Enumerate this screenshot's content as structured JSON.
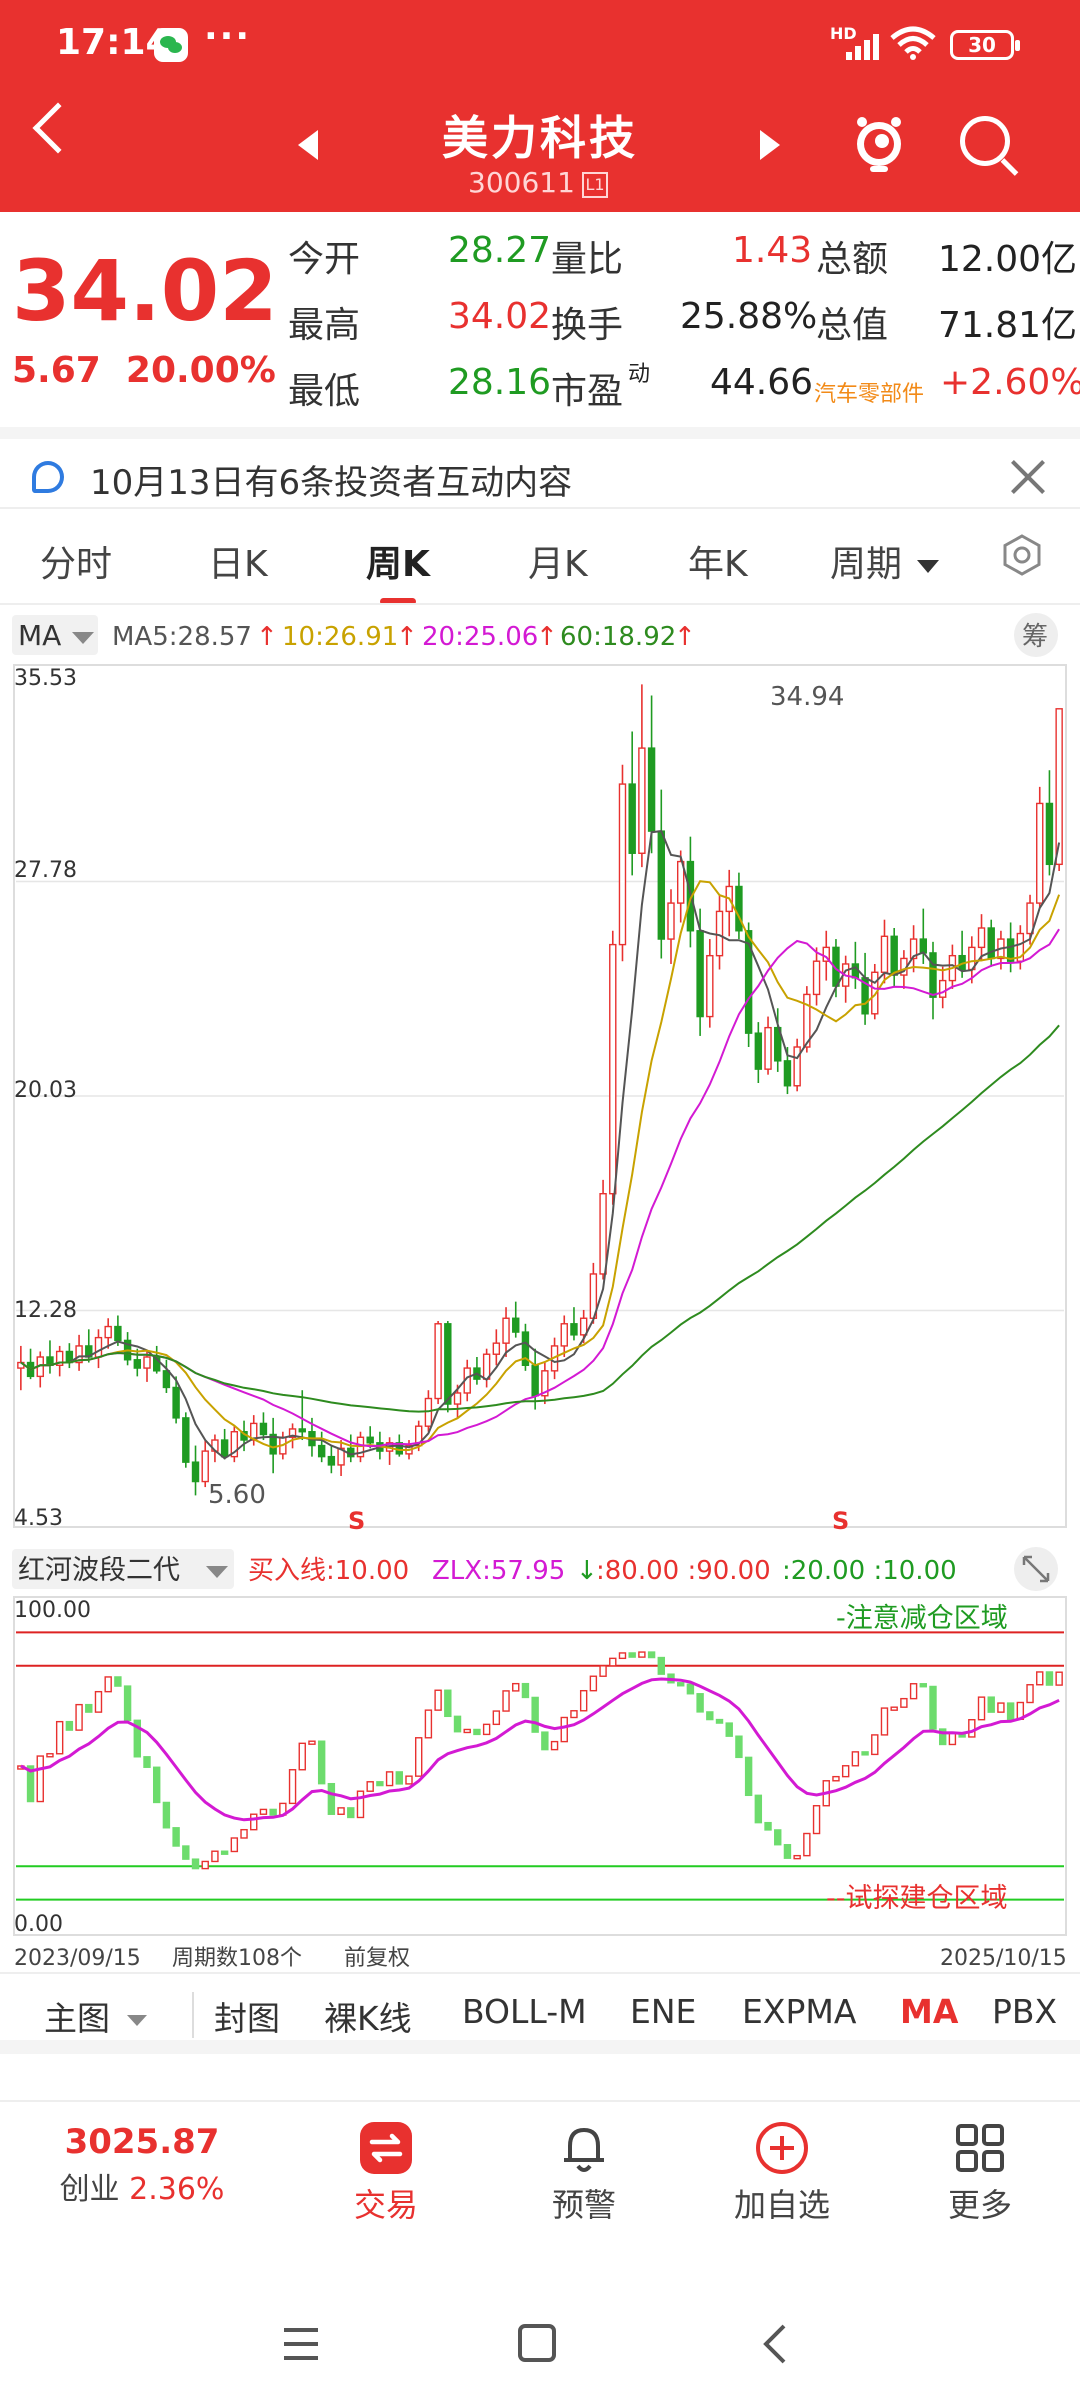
{
  "status": {
    "time": "17:14",
    "dots": "···",
    "network": "HD",
    "battery": "30"
  },
  "header": {
    "name": "美力科技",
    "code": "300611",
    "level": "L1"
  },
  "quote": {
    "price": "34.02",
    "change": "5.67",
    "change_pct": "20.00%",
    "open_label": "今开",
    "open": "28.27",
    "high_label": "最高",
    "high": "34.02",
    "low_label": "最低",
    "low": "28.16",
    "vol_ratio_label": "量比",
    "vol_ratio": "1.43",
    "turnover_label": "换手",
    "turnover": "25.88%",
    "pe_label": "市盈",
    "pe_sup": "动",
    "pe": "44.66",
    "amount_label": "总额",
    "amount": "12.00亿",
    "mcap_label": "总值",
    "mcap": "71.81亿",
    "sector": "汽车零部件",
    "sector_pct": "+2.60%"
  },
  "notice": {
    "text": "10月13日有6条投资者互动内容"
  },
  "tabs": [
    "分时",
    "日K",
    "周K",
    "月K",
    "年K",
    "周期"
  ],
  "active_tab": "周K",
  "ma_bar": {
    "selector": "MA",
    "ma5": "MA5:28.57",
    "ma10": "10:26.91",
    "ma20": "20:25.06",
    "ma60": "60:18.92",
    "chip_label": "筹"
  },
  "chart_data": [
    {
      "type": "candlestick",
      "period": "weekly",
      "ylim": [
        4.53,
        35.53
      ],
      "y_ticks": [
        "35.53",
        "27.78",
        "20.03",
        "12.28",
        "4.53"
      ],
      "high_label": "34.94",
      "low_label": "5.60",
      "markers": [
        "S",
        "S"
      ],
      "series": [
        {
          "name": "MA5",
          "color": "#555555"
        },
        {
          "name": "MA10",
          "color": "#c8a200"
        },
        {
          "name": "MA20",
          "color": "#d31ad3"
        },
        {
          "name": "MA60",
          "color": "#2e8b1f"
        }
      ],
      "candles_ohlc": [
        [
          10.2,
          11.0,
          9.4,
          10.4
        ],
        [
          10.4,
          10.9,
          9.8,
          9.9
        ],
        [
          9.9,
          10.8,
          9.5,
          10.6
        ],
        [
          10.6,
          11.2,
          10.0,
          10.3
        ],
        [
          10.3,
          11.0,
          9.9,
          10.8
        ],
        [
          10.8,
          11.1,
          10.2,
          10.4
        ],
        [
          10.4,
          11.4,
          10.1,
          11.0
        ],
        [
          11.0,
          11.6,
          10.4,
          10.6
        ],
        [
          10.6,
          11.6,
          10.2,
          11.3
        ],
        [
          11.3,
          12.0,
          10.9,
          11.7
        ],
        [
          11.7,
          12.1,
          11.0,
          11.2
        ],
        [
          11.2,
          11.5,
          10.3,
          10.5
        ],
        [
          10.5,
          10.9,
          9.9,
          10.2
        ],
        [
          10.2,
          10.8,
          9.7,
          10.6
        ],
        [
          10.6,
          11.0,
          10.0,
          10.1
        ],
        [
          10.1,
          10.5,
          9.3,
          9.5
        ],
        [
          9.5,
          9.9,
          8.2,
          8.4
        ],
        [
          8.4,
          8.6,
          6.6,
          6.8
        ],
        [
          6.8,
          7.4,
          5.6,
          6.1
        ],
        [
          6.1,
          7.6,
          5.9,
          7.2
        ],
        [
          7.2,
          7.8,
          6.8,
          7.6
        ],
        [
          7.6,
          8.0,
          6.9,
          7.0
        ],
        [
          7.0,
          8.1,
          6.8,
          7.9
        ],
        [
          7.9,
          8.3,
          7.2,
          7.6
        ],
        [
          7.6,
          8.5,
          7.4,
          8.2
        ],
        [
          8.2,
          8.6,
          7.6,
          7.8
        ],
        [
          7.8,
          8.4,
          6.4,
          7.1
        ],
        [
          7.1,
          7.9,
          6.9,
          7.7
        ],
        [
          7.7,
          8.2,
          7.3,
          8.0
        ],
        [
          8.0,
          9.4,
          7.6,
          7.9
        ],
        [
          7.9,
          8.4,
          7.0,
          7.4
        ],
        [
          7.4,
          7.9,
          6.8,
          7.0
        ],
        [
          7.0,
          7.4,
          6.4,
          6.7
        ],
        [
          6.7,
          7.6,
          6.3,
          7.3
        ],
        [
          7.3,
          7.8,
          6.8,
          7.0
        ],
        [
          7.0,
          7.9,
          6.8,
          7.7
        ],
        [
          7.7,
          8.1,
          7.3,
          7.5
        ],
        [
          7.5,
          7.9,
          6.9,
          7.2
        ],
        [
          7.2,
          7.7,
          6.7,
          7.5
        ],
        [
          7.5,
          7.8,
          7.0,
          7.1
        ],
        [
          7.1,
          7.6,
          6.9,
          7.4
        ],
        [
          7.4,
          8.3,
          7.2,
          8.1
        ],
        [
          8.1,
          9.4,
          7.9,
          9.1
        ],
        [
          9.1,
          11.9,
          8.9,
          11.8
        ],
        [
          11.8,
          11.9,
          8.6,
          8.9
        ],
        [
          8.9,
          9.6,
          8.4,
          9.3
        ],
        [
          9.3,
          10.5,
          9.0,
          10.2
        ],
        [
          10.2,
          10.6,
          9.6,
          9.8
        ],
        [
          9.8,
          10.9,
          9.5,
          10.7
        ],
        [
          10.7,
          11.6,
          10.3,
          11.1
        ],
        [
          11.1,
          12.4,
          10.6,
          12.0
        ],
        [
          12.0,
          12.6,
          11.3,
          11.5
        ],
        [
          11.5,
          11.8,
          10.1,
          10.3
        ],
        [
          10.3,
          10.9,
          8.7,
          9.2
        ],
        [
          9.2,
          10.4,
          8.9,
          10.1
        ],
        [
          10.1,
          11.3,
          9.8,
          11.0
        ],
        [
          11.0,
          12.1,
          10.6,
          11.8
        ],
        [
          11.8,
          12.4,
          11.2,
          11.4
        ],
        [
          11.4,
          12.3,
          11.1,
          12.0
        ],
        [
          12.0,
          14.0,
          11.8,
          13.6
        ],
        [
          13.6,
          17.0,
          13.4,
          16.5
        ],
        [
          16.5,
          26.0,
          16.1,
          25.5
        ],
        [
          25.5,
          32.0,
          24.9,
          31.3
        ],
        [
          31.3,
          33.2,
          28.0,
          28.8
        ],
        [
          28.8,
          34.9,
          28.3,
          32.6
        ],
        [
          32.6,
          34.5,
          28.8,
          29.6
        ],
        [
          29.6,
          31.1,
          25.0,
          25.7
        ],
        [
          25.7,
          27.5,
          24.8,
          27.0
        ],
        [
          27.0,
          28.9,
          26.3,
          28.5
        ],
        [
          28.5,
          29.4,
          25.4,
          26.0
        ],
        [
          26.0,
          26.8,
          22.2,
          22.9
        ],
        [
          22.9,
          25.7,
          22.5,
          25.1
        ],
        [
          25.1,
          27.3,
          24.6,
          26.7
        ],
        [
          26.7,
          28.2,
          25.8,
          27.6
        ],
        [
          27.6,
          28.1,
          25.7,
          26.0
        ],
        [
          26.0,
          26.3,
          21.8,
          22.3
        ],
        [
          22.3,
          22.7,
          20.5,
          21.0
        ],
        [
          21.0,
          22.9,
          20.8,
          22.5
        ],
        [
          22.5,
          23.2,
          20.9,
          21.3
        ],
        [
          21.3,
          21.8,
          20.1,
          20.4
        ],
        [
          20.4,
          22.1,
          20.2,
          21.8
        ],
        [
          21.8,
          24.0,
          21.6,
          23.7
        ],
        [
          23.7,
          25.4,
          23.3,
          24.9
        ],
        [
          24.9,
          26.0,
          24.2,
          25.4
        ],
        [
          25.4,
          25.7,
          23.6,
          24.0
        ],
        [
          24.0,
          25.1,
          23.4,
          24.8
        ],
        [
          24.8,
          25.6,
          23.9,
          24.3
        ],
        [
          24.3,
          25.2,
          22.6,
          23.0
        ],
        [
          23.0,
          24.8,
          22.8,
          24.5
        ],
        [
          24.5,
          26.4,
          24.1,
          25.8
        ],
        [
          25.8,
          26.1,
          24.0,
          24.4
        ],
        [
          24.4,
          25.3,
          23.9,
          25.0
        ],
        [
          25.0,
          26.2,
          24.5,
          25.7
        ],
        [
          25.7,
          26.8,
          24.8,
          25.2
        ],
        [
          25.2,
          25.6,
          22.8,
          23.6
        ],
        [
          23.6,
          24.7,
          23.2,
          24.2
        ],
        [
          24.2,
          25.5,
          23.9,
          25.1
        ],
        [
          25.1,
          26.0,
          24.3,
          24.6
        ],
        [
          24.6,
          25.8,
          24.1,
          25.4
        ],
        [
          25.4,
          26.6,
          24.9,
          26.1
        ],
        [
          26.1,
          26.4,
          24.7,
          25.0
        ],
        [
          25.0,
          26.0,
          24.6,
          25.7
        ],
        [
          25.7,
          26.3,
          24.5,
          24.9
        ],
        [
          24.9,
          26.2,
          24.6,
          25.9
        ],
        [
          25.9,
          27.3,
          25.5,
          27.0
        ],
        [
          27.0,
          31.2,
          26.8,
          30.6
        ],
        [
          30.6,
          31.8,
          28.0,
          28.4
        ],
        [
          28.4,
          34.02,
          28.16,
          34.02
        ]
      ]
    },
    {
      "type": "line",
      "name": "红河波段二代",
      "ylim": [
        0,
        100
      ],
      "y_ticks": [
        "100.00",
        "0.00"
      ],
      "levels": [
        80,
        90,
        20,
        10
      ],
      "zones": [
        "-注意减仓区域",
        "--试探建仓区域"
      ],
      "buy_line": "10.00",
      "zlx": "57.95"
    }
  ],
  "indicator_bar": {
    "selector": "红河波段二代",
    "buy_label": "买入线:10.00",
    "zlx_label": "ZLX:57.95",
    "levels_label": ":80.00 :90.00",
    "low_levels_label": ":20.00 :10.00"
  },
  "footer": {
    "start": "2023/09/15",
    "count": "周期数108个",
    "adjust": "前复权",
    "end": "2025/10/15"
  },
  "indicator_tabs": [
    "主图",
    "封图",
    "裸K线",
    "BOLL-M",
    "ENE",
    "EXPMA",
    "MA",
    "PBX"
  ],
  "active_indicator": "MA",
  "bottom_nav": {
    "index_value": "3025.87",
    "index_name": "创业",
    "index_pct": "2.36%",
    "trade": "交易",
    "alert": "预警",
    "add": "加自选",
    "more": "更多"
  },
  "colors": {
    "red": "#e8312f",
    "green": "#1f9b22",
    "header": "#e8312f"
  }
}
